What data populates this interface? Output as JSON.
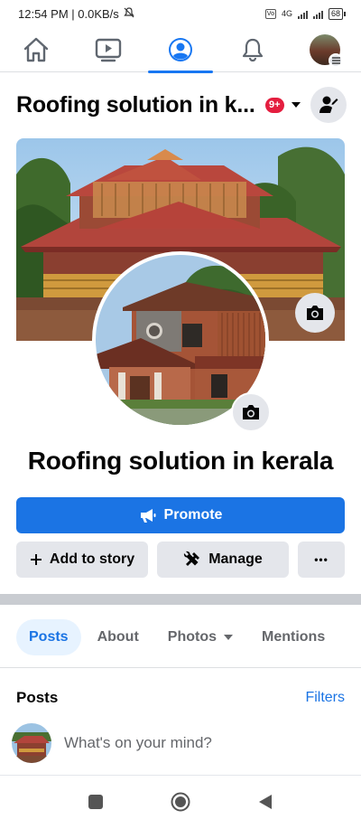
{
  "status_bar": {
    "time": "12:54 PM | 0.0KB/s",
    "network_type": "4G",
    "vo_label": "Vo",
    "battery_level": "68"
  },
  "top_nav": {
    "items": [
      "home-icon",
      "watch-icon",
      "profile-icon",
      "notifications-icon",
      "avatar-menu"
    ],
    "active_index": 2,
    "accent_color": "#1877f2"
  },
  "page_header": {
    "title": "Roofing solution in k...",
    "notification_badge": "9+"
  },
  "page_name": "Roofing solution in kerala",
  "actions": {
    "promote_label": "Promote",
    "add_to_story_label": "Add to story",
    "manage_label": "Manage",
    "more_label": "•••"
  },
  "tabs": [
    {
      "label": "Posts",
      "active": true
    },
    {
      "label": "About",
      "active": false
    },
    {
      "label": "Photos",
      "active": false
    },
    {
      "label": "Mentions",
      "active": false
    }
  ],
  "posts_section": {
    "title": "Posts",
    "filters_label": "Filters",
    "composer_placeholder": "What's on your mind?"
  },
  "colors": {
    "primary_blue": "#1b74e4",
    "badge_red": "#e41e3f",
    "button_gray": "#e4e6eb"
  }
}
